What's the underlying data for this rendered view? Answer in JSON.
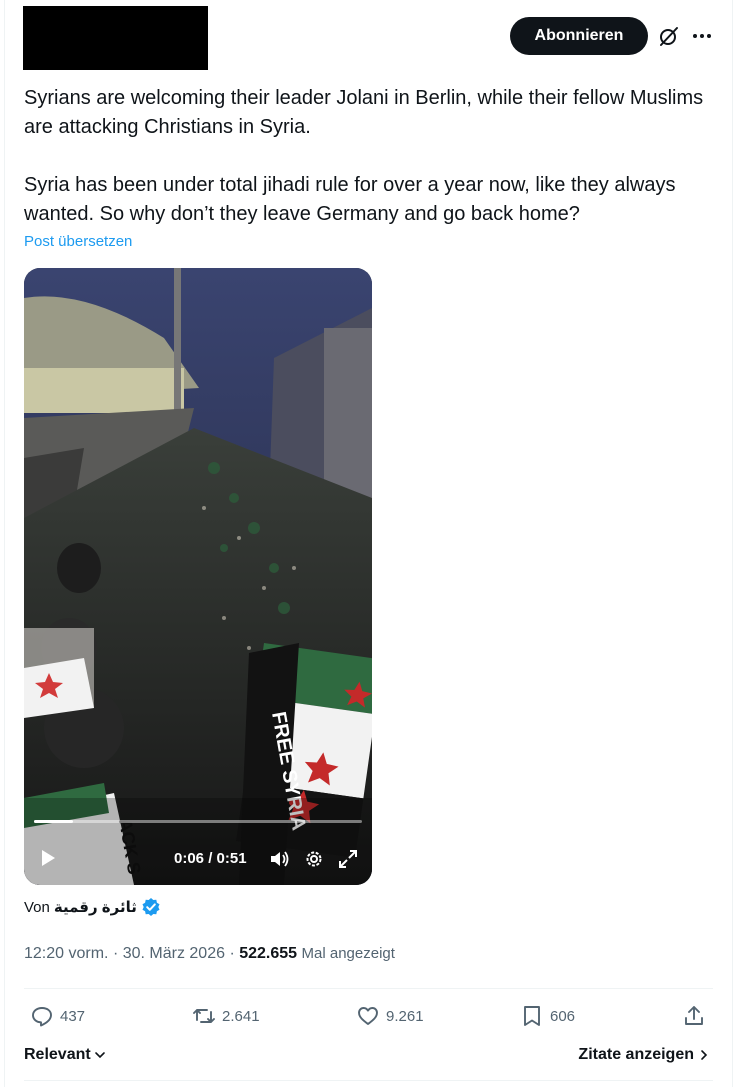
{
  "header": {
    "subscribe_label": "Abonnieren",
    "grok_icon": "grok-icon",
    "more_icon": "more-icon"
  },
  "tweet": {
    "paragraphs": [
      "Syrians are welcoming their leader Jolani in Berlin, while their fellow Muslims are attacking Christians in Syria.",
      "Syria has been under total jihadi rule for over a year now, like they always wanted. So why don’t they leave Germany and go back home?"
    ],
    "translate_label": "Post übersetzen"
  },
  "video": {
    "current_time": "0:06",
    "duration": "0:51",
    "time_display": "0:06 / 0:51",
    "progress": 0.12,
    "flag_text": "FREE SYRIA",
    "flag_text_2": "ACK S"
  },
  "source": {
    "prefix": "Von",
    "author": "ثائرة رقمية",
    "verified_color": "#1d9bf0"
  },
  "meta": {
    "time": "12:20 vorm.",
    "date": "30. März 2026",
    "views": "522.655",
    "views_label": "Mal angezeigt"
  },
  "actions": {
    "replies": "437",
    "reposts": "2.641",
    "likes": "9.261",
    "bookmarks": "606"
  },
  "footer": {
    "sort_label": "Relevant",
    "quotes_label": "Zitate anzeigen"
  },
  "colors": {
    "accent": "#1d9bf0",
    "text": "#0f1419",
    "muted": "#536471"
  }
}
